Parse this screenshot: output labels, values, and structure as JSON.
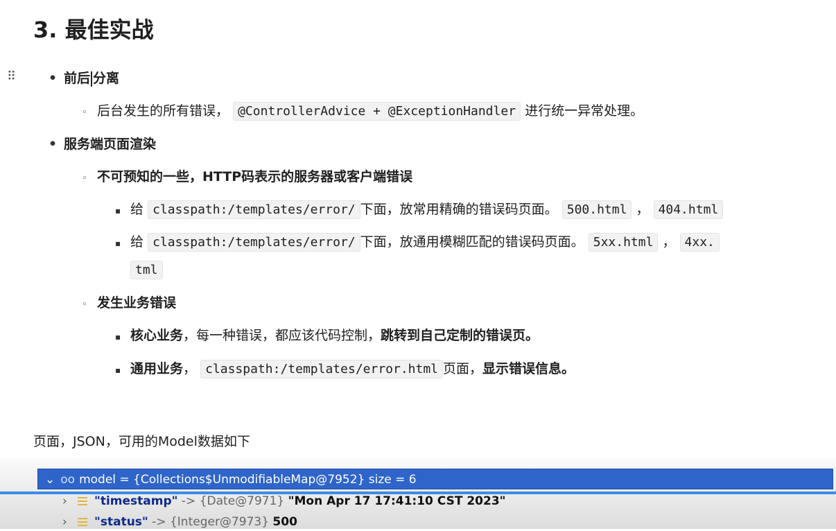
{
  "title": "3. 最佳实战",
  "items": {
    "separation": {
      "label_pre": "前后",
      "label_post": "分离"
    },
    "separation_sub": {
      "text_pre": "后台发生的所有错误，",
      "code": "@ControllerAdvice + @ExceptionHandler",
      "text_post": "进行统一异常处理。"
    },
    "ssr": {
      "label": "服务端页面渲染"
    },
    "unexpected": {
      "label": "不可预知的一些，HTTP码表示的服务器或客户端错误"
    },
    "exact": {
      "pre": "给",
      "code": "classpath:/templates/error/",
      "mid": "下面，放常用精确的错误码页面。",
      "code2": "500.html",
      "sep": "，",
      "code3": "404.html"
    },
    "fuzzy": {
      "pre": "给",
      "code": "classpath:/templates/error/",
      "mid": "下面，放通用模糊匹配的错误码页面。",
      "code2": "5xx.html",
      "sep": "，",
      "code3": "4xx.",
      "wrap": "tml"
    },
    "business": {
      "label": "发生业务错误"
    },
    "core": {
      "bold1": "核心业务",
      "text": "，每一种错误，都应该代码控制，",
      "bold2": "跳转到自己定制的错误页。"
    },
    "general": {
      "bold1": "通用业务",
      "text": "，",
      "code": "classpath:/templates/error.html",
      "text2": "页面，",
      "bold2": "显示错误信息。"
    }
  },
  "paragraph": "页面，JSON，可用的Model数据如下",
  "debugger": {
    "model_row": "model = {Collections$UnmodifiableMap@7952}  size = 6",
    "rows": [
      {
        "key": "\"timestamp\"",
        "ref": " -> {Date@7971} ",
        "value": "\"Mon Apr 17 17:41:10 CST 2023\""
      },
      {
        "key": "\"status\"",
        "ref": " -> {Integer@7973} ",
        "value": "500"
      }
    ]
  },
  "icons": {
    "drag": "drag-handle-icon",
    "expand": "chevron-down-icon",
    "collapsed": "chevron-right-icon",
    "watch": "glasses-icon",
    "field": "field-icon"
  }
}
